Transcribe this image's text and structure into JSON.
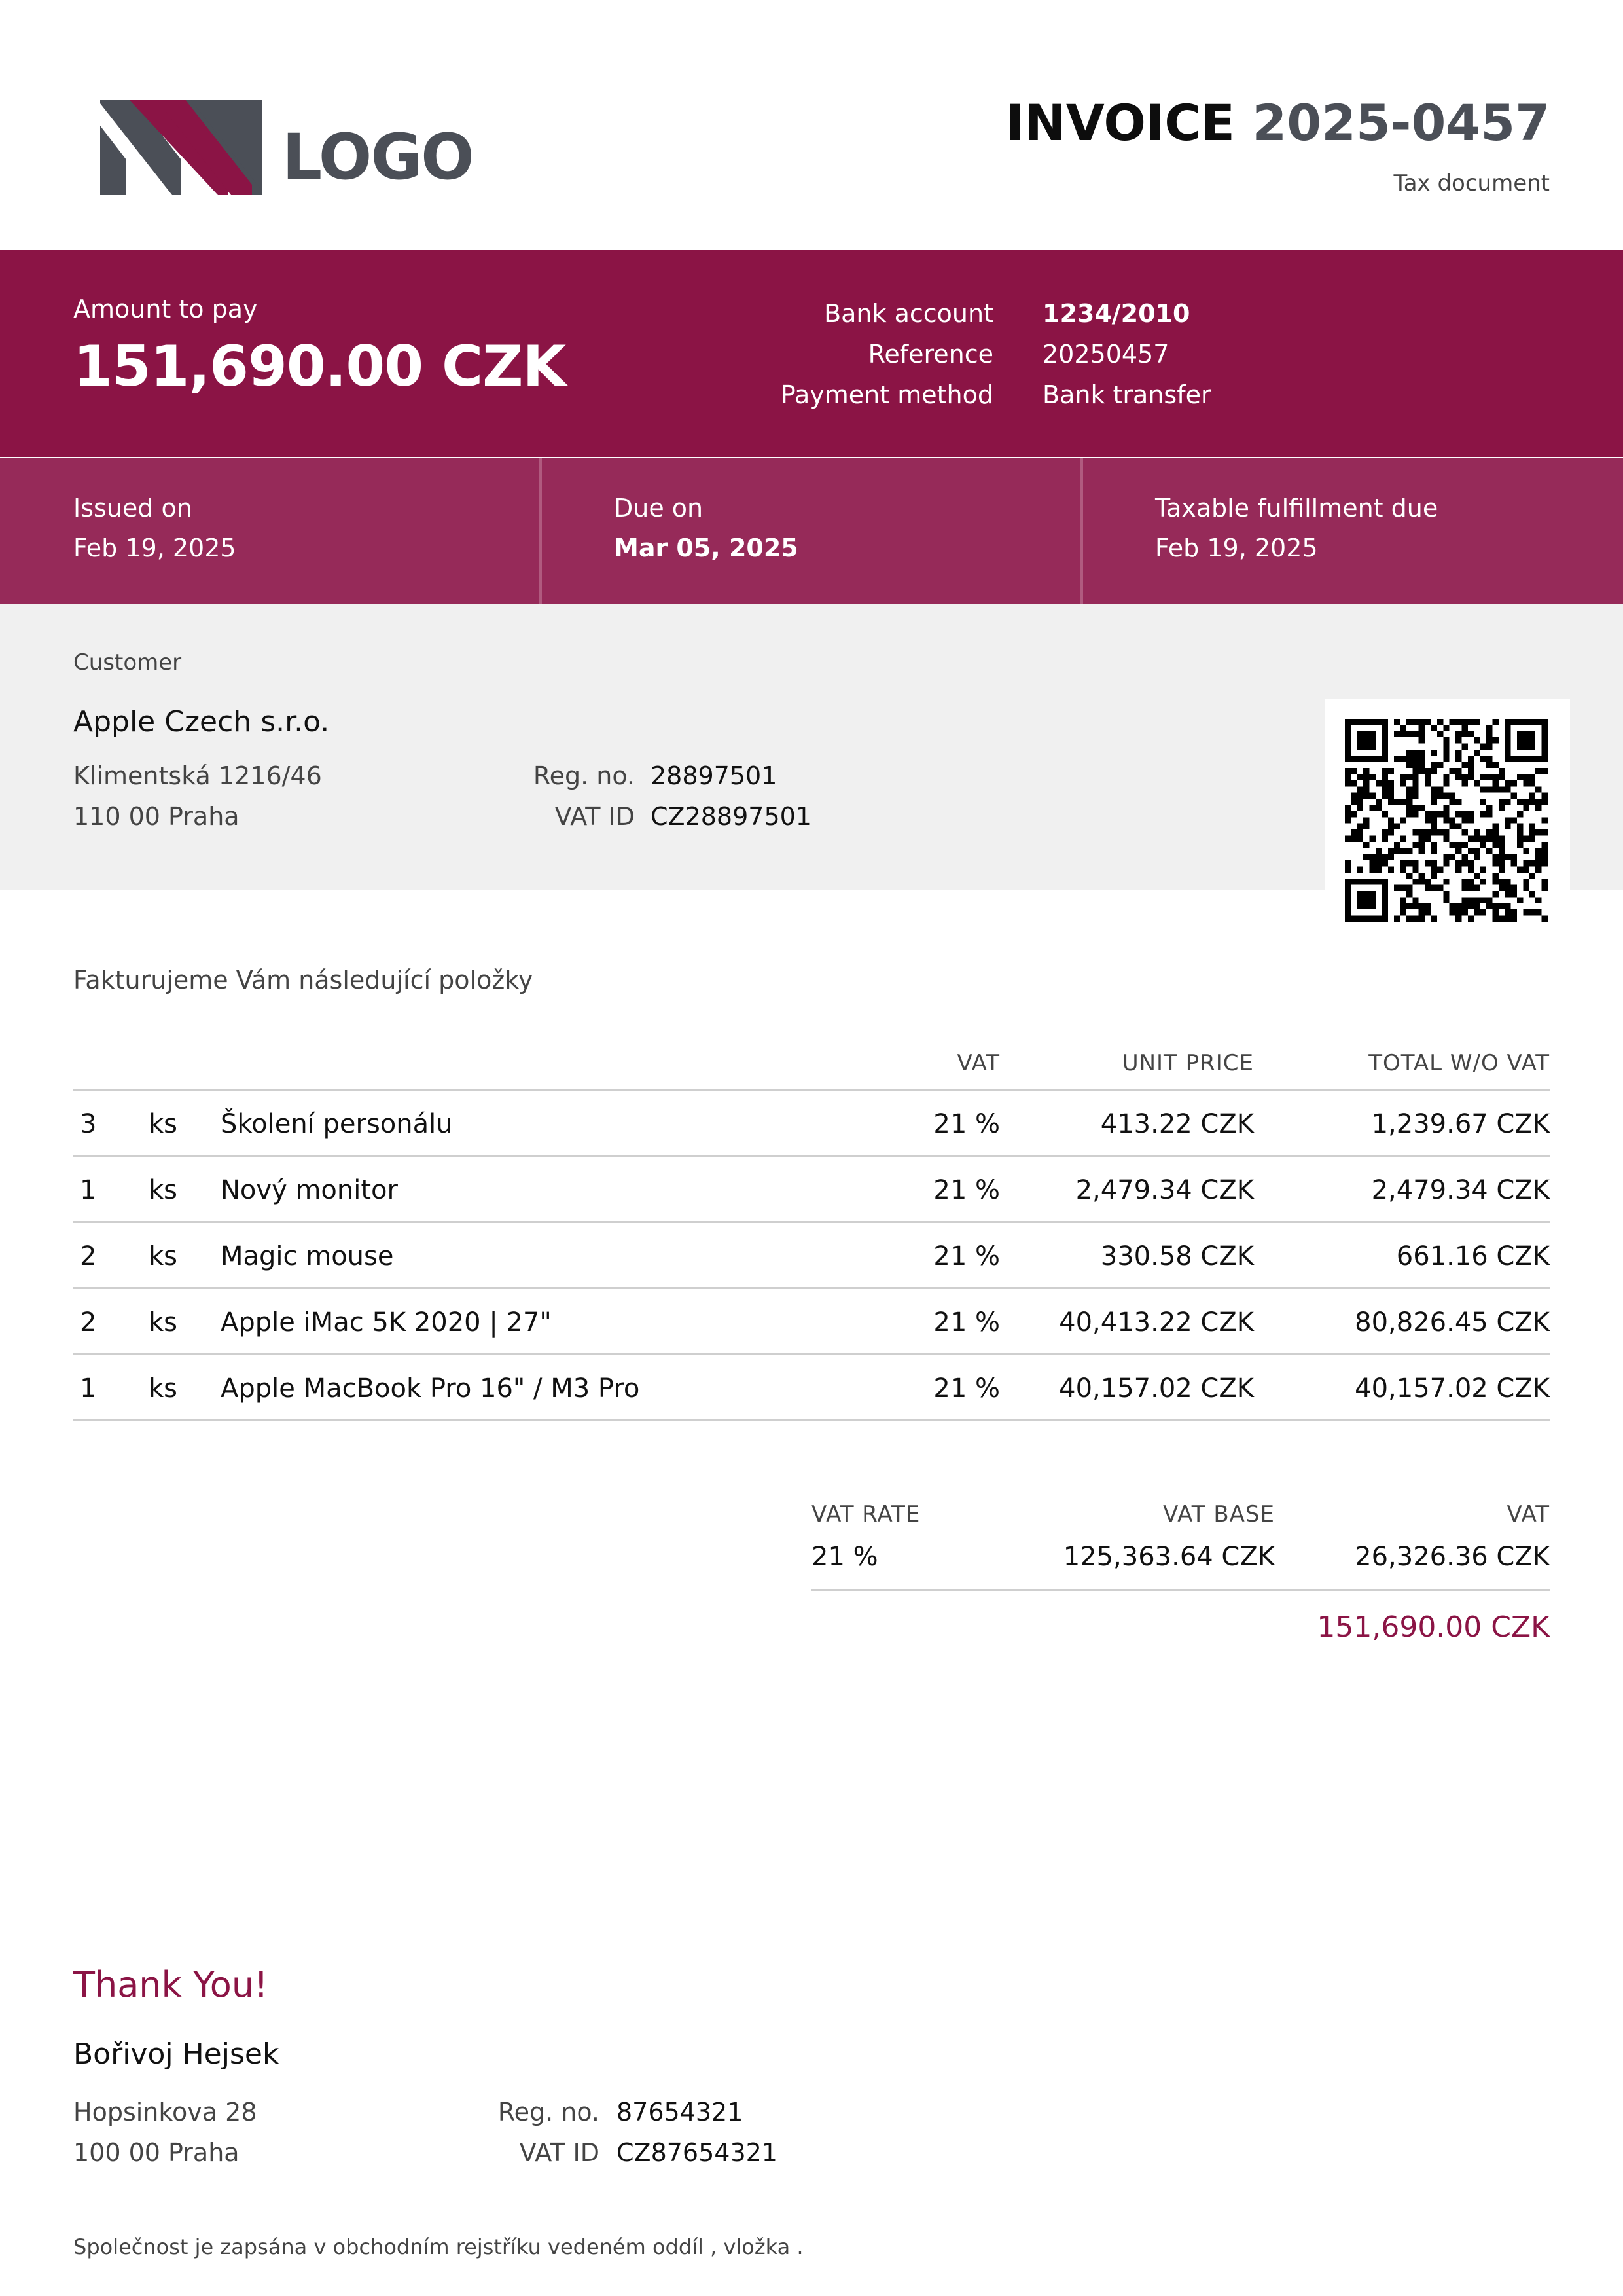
{
  "logo": {
    "text": "LOGO",
    "colors": {
      "dark": "#4b4f57",
      "accent": "#8b1445"
    }
  },
  "header": {
    "title_word": "INVOICE",
    "title_number": "2025-0457",
    "subtitle": "Tax document"
  },
  "payment": {
    "amount_label": "Amount to pay",
    "amount_value": "151,690.00 CZK",
    "bank_account_label": "Bank account",
    "bank_account_value": "1234/2010",
    "reference_label": "Reference",
    "reference_value": "20250457",
    "method_label": "Payment method",
    "method_value": "Bank transfer"
  },
  "dates": {
    "issued_label": "Issued on",
    "issued_value": "Feb 19, 2025",
    "due_label": "Due on",
    "due_value": "Mar 05, 2025",
    "taxable_label": "Taxable fulfillment due",
    "taxable_value": "Feb 19, 2025"
  },
  "customer": {
    "section_label": "Customer",
    "name": "Apple Czech s.r.o.",
    "street": "Klimentská 1216/46",
    "city": "110 00 Praha",
    "reg_label": "Reg. no.",
    "reg_value": "28897501",
    "vat_label": "VAT ID",
    "vat_value": "CZ28897501"
  },
  "qr": {
    "icon": "payment-qr-code"
  },
  "items_intro": "Fakturujeme Vám následující položky",
  "items_table": {
    "headers": {
      "vat": "VAT",
      "unit_price": "UNIT PRICE",
      "total": "TOTAL W/O VAT"
    },
    "rows": [
      {
        "qty": "3",
        "unit": "ks",
        "name": "Školení personálu",
        "vat": "21 %",
        "unit_price": "413.22 CZK",
        "total": "1,239.67 CZK"
      },
      {
        "qty": "1",
        "unit": "ks",
        "name": "Nový monitor",
        "vat": "21 %",
        "unit_price": "2,479.34 CZK",
        "total": "2,479.34 CZK"
      },
      {
        "qty": "2",
        "unit": "ks",
        "name": "Magic mouse",
        "vat": "21 %",
        "unit_price": "330.58 CZK",
        "total": "661.16 CZK"
      },
      {
        "qty": "2",
        "unit": "ks",
        "name": "Apple iMac 5K 2020 | 27\"",
        "vat": "21 %",
        "unit_price": "40,413.22 CZK",
        "total": "80,826.45 CZK"
      },
      {
        "qty": "1",
        "unit": "ks",
        "name": "Apple MacBook Pro 16\" / M3 Pro",
        "vat": "21 %",
        "unit_price": "40,157.02 CZK",
        "total": "40,157.02 CZK"
      }
    ]
  },
  "vat_summary": {
    "headers": {
      "rate": "VAT RATE",
      "base": "VAT BASE",
      "vat": "VAT"
    },
    "rows": [
      {
        "rate": "21 %",
        "base": "125,363.64 CZK",
        "vat": "26,326.36 CZK"
      }
    ],
    "grand_total": "151,690.00 CZK"
  },
  "supplier": {
    "thanks": "Thank You!",
    "name": "Bořivoj Hejsek",
    "street": "Hopsinkova 28",
    "city": "100 00 Praha",
    "reg_label": "Reg. no.",
    "reg_value": "87654321",
    "vat_label": "VAT ID",
    "vat_value": "CZ87654321"
  },
  "footer": {
    "note": "Společnost je zapsána v obchodním rejstříku vedeném oddíl , vložka ."
  },
  "colors": {
    "primary": "#8b1445",
    "secondary": "#962a59",
    "customer_bg": "#f0f0f0"
  }
}
